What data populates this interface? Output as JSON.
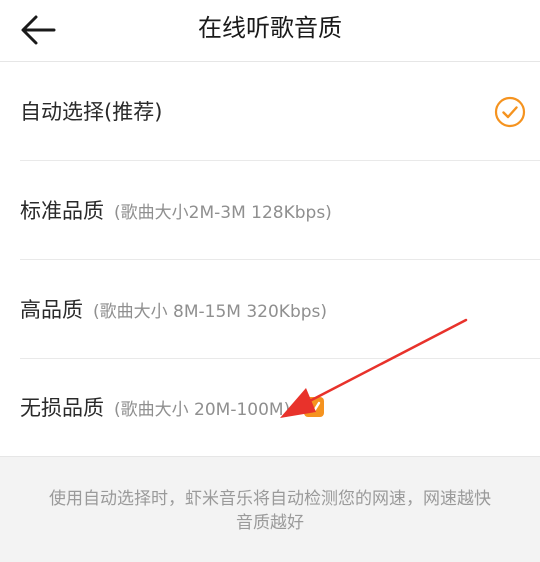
{
  "header": {
    "title": "在线听歌音质",
    "back_icon": "arrow-left-icon"
  },
  "options": [
    {
      "label": "自动选择(推荐)",
      "sub": "",
      "selected": true
    },
    {
      "label": "标准品质",
      "sub": "(歌曲大小2M-3M 128Kbps)",
      "selected": false
    },
    {
      "label": "高品质",
      "sub": "(歌曲大小 8M-15M 320Kbps)",
      "selected": false
    },
    {
      "label": "无损品质",
      "sub": "(歌曲大小 20M-100M)",
      "selected": false,
      "vip": true,
      "vip_badge_text": "V"
    }
  ],
  "footer": {
    "line1": "使用自动选择时，虾米音乐将自动检测您的网速，网速越快",
    "line2": "音质越好"
  },
  "colors": {
    "accent": "#f5931f",
    "annotation_arrow": "#e8322b"
  }
}
